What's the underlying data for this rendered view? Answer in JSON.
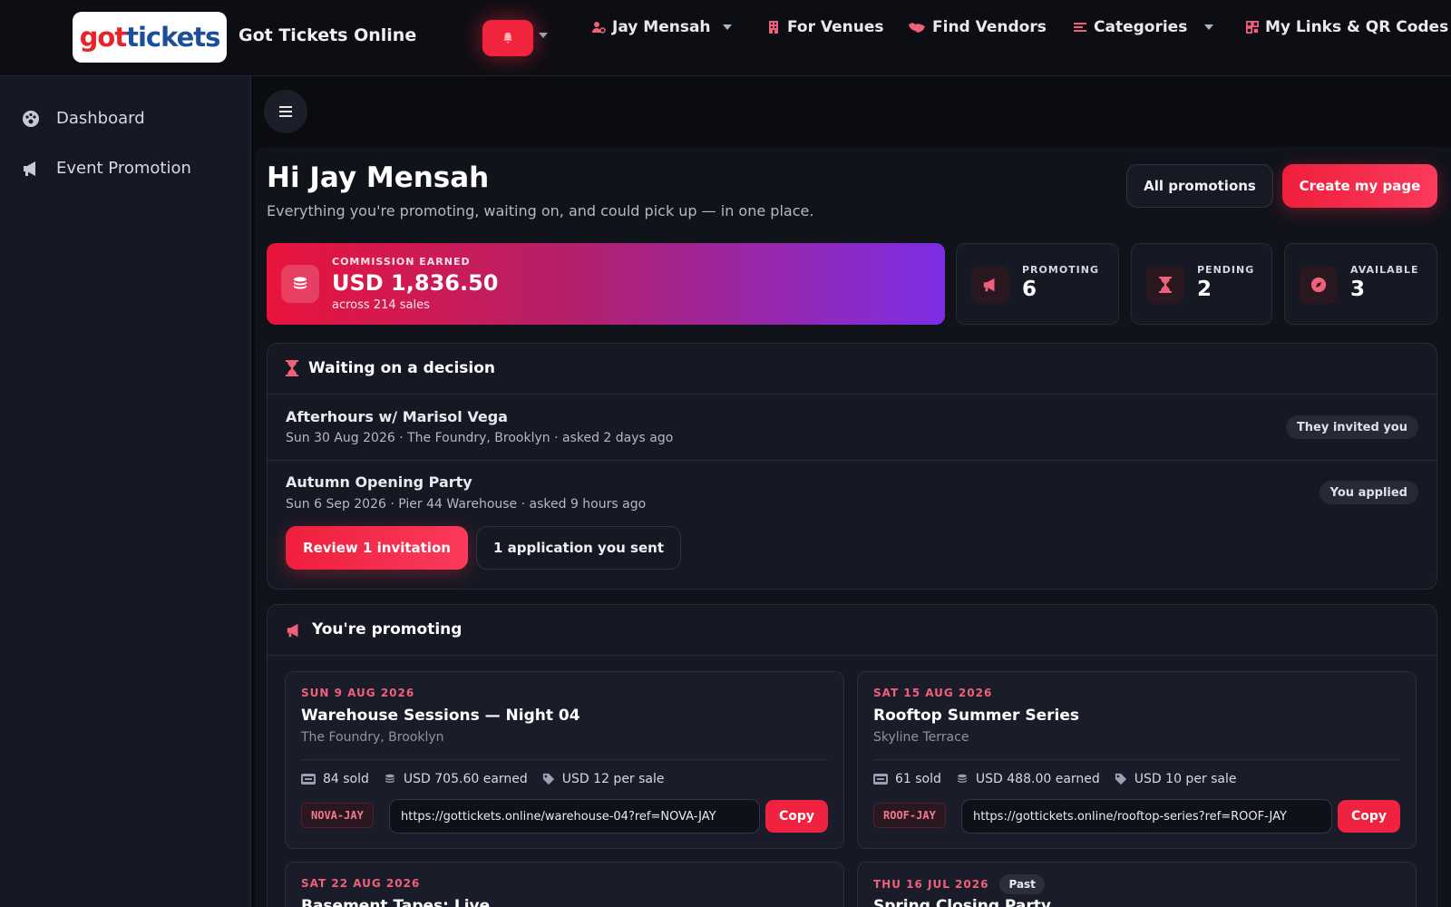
{
  "brand": {
    "logo_part1": "got",
    "logo_part2": "ti",
    "logo_part3": "ckets",
    "name": "Got Tickets Online"
  },
  "nav": {
    "user": "Jay Mensah",
    "venues": "For Venues",
    "vendors": "Find Vendors",
    "categories": "Categories",
    "links": "My Links & QR Codes"
  },
  "sidebar": {
    "items": [
      {
        "label": "Dashboard",
        "icon": "palette-icon"
      },
      {
        "label": "Event Promotion",
        "icon": "megaphone-icon"
      }
    ]
  },
  "header": {
    "greeting": "Hi Jay Mensah",
    "subtitle": "Everything you're promoting, waiting on, and could pick up — in one place.",
    "all_promotions": "All promotions",
    "create_page": "Create my page"
  },
  "commission": {
    "label": "COMMISSION EARNED",
    "value": "USD 1,836.50",
    "sub": "across 214 sales"
  },
  "stats": [
    {
      "label": "PROMOTING",
      "value": "6",
      "icon": "megaphone-icon"
    },
    {
      "label": "PENDING",
      "value": "2",
      "icon": "hourglass-icon"
    },
    {
      "label": "AVAILABLE",
      "value": "3",
      "icon": "compass-icon"
    }
  ],
  "waiting": {
    "title": "Waiting on a decision",
    "rows": [
      {
        "title": "Afterhours w/ Marisol Vega",
        "sub": "Sun 30 Aug 2026 · The Foundry, Brooklyn · asked 2 days ago",
        "pill": "They invited you"
      },
      {
        "title": "Autumn Opening Party",
        "sub": "Sun 6 Sep 2026 · Pier 44 Warehouse · asked 9 hours ago",
        "pill": "You applied"
      }
    ],
    "review_btn": "Review 1 invitation",
    "applications_btn": "1 application you sent"
  },
  "promoting": {
    "title": "You're promoting",
    "cards": [
      {
        "date": "SUN 9 AUG 2026",
        "title": "Warehouse Sessions — Night 04",
        "venue": "The Foundry, Brooklyn",
        "sold": "84 sold",
        "earned": "USD 705.60 earned",
        "per_sale": "USD 12 per sale",
        "code": "NOVA-JAY",
        "link": "https://gottickets.online/warehouse-04?ref=NOVA-JAY",
        "copy": "Copy"
      },
      {
        "date": "SAT 15 AUG 2026",
        "title": "Rooftop Summer Series",
        "venue": "Skyline Terrace",
        "sold": "61 sold",
        "earned": "USD 488.00 earned",
        "per_sale": "USD 10 per sale",
        "code": "ROOF-JAY",
        "link": "https://gottickets.online/rooftop-series?ref=ROOF-JAY",
        "copy": "Copy"
      },
      {
        "date": "SAT 22 AUG 2026",
        "title": "Basement Tapes: Live"
      },
      {
        "date": "THU 16 JUL 2026",
        "badge": "Past",
        "title": "Spring Closing Party"
      }
    ]
  },
  "colors": {
    "accent": "#f0243d",
    "bg": "#0b0c10",
    "panel": "#161924",
    "gradient_end": "#7c2ee6"
  }
}
